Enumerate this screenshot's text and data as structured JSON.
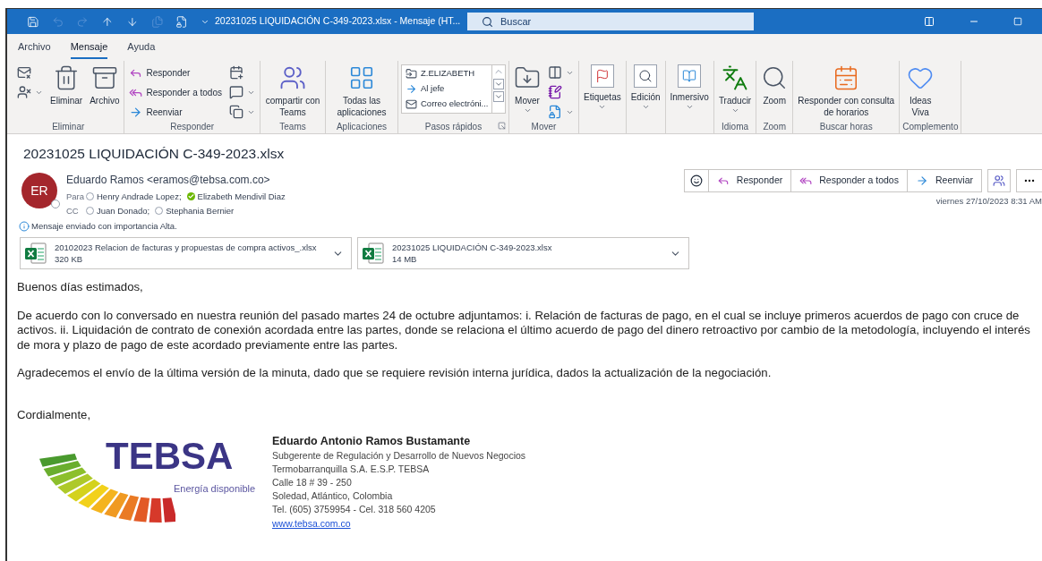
{
  "titlebar": {
    "title": "20231025 LIQUIDACIÓN C-349-2023.xlsx  -  Mensaje (HT...",
    "search": {
      "placeholder": "Buscar"
    }
  },
  "menu_tabs": [
    {
      "label": "Archivo",
      "selected": false
    },
    {
      "label": "Mensaje",
      "selected": true
    },
    {
      "label": "Ayuda",
      "selected": false
    }
  ],
  "ribbon_groups": [
    {
      "label": "Eliminar",
      "columns": [
        {
          "kind": "stack",
          "items": [
            {
              "dropdown": false
            },
            {
              "dropdown": true
            }
          ]
        },
        {
          "kind": "large",
          "label": "Eliminar",
          "dropdown": false
        },
        {
          "kind": "large",
          "label": "Archivo",
          "dropdown": false
        }
      ]
    },
    {
      "label": "Responder",
      "columns": [
        {
          "kind": "stack",
          "items": [
            {
              "label": "Responder",
              "dropdown": false
            },
            {
              "label": "Responder a todos",
              "dropdown": false
            },
            {
              "label": "Reenviar",
              "dropdown": false
            }
          ]
        },
        {
          "kind": "stack",
          "items": [
            {
              "dropdown": false
            },
            {
              "dropdown": true
            },
            {
              "dropdown": true
            }
          ]
        }
      ]
    },
    {
      "label": "Teams",
      "columns": [
        {
          "kind": "large",
          "label": "compartir con Teams",
          "dropdown": false
        }
      ]
    },
    {
      "label": "Aplicaciones",
      "columns": [
        {
          "kind": "large",
          "label": "Todas las aplicaciones",
          "dropdown": false
        }
      ]
    },
    {
      "label": "Pasos rápidos",
      "launcher": true,
      "columns": [
        {
          "kind": "quicksteps",
          "items": [
            "Z.ELIZABETH",
            "Al jefe",
            "Correo electróni..."
          ]
        }
      ]
    },
    {
      "label": "Mover",
      "columns": [
        {
          "kind": "large",
          "label": "Mover",
          "dropdown": true
        },
        {
          "kind": "stack",
          "items": [
            {
              "dropdown": true
            },
            {
              "dropdown": false
            },
            {
              "dropdown": true
            }
          ]
        }
      ]
    },
    {
      "columns": [
        {
          "kind": "large",
          "label": "Etiquetas",
          "dropdown": true
        }
      ]
    },
    {
      "columns": [
        {
          "kind": "large",
          "label": "Edición",
          "dropdown": true
        }
      ]
    },
    {
      "columns": [
        {
          "kind": "large",
          "label": "Inmersivo",
          "dropdown": true
        }
      ]
    },
    {
      "label": "Idioma",
      "columns": [
        {
          "kind": "large",
          "label": "Traducir",
          "dropdown": true
        }
      ]
    },
    {
      "label": "Zoom",
      "columns": [
        {
          "kind": "large",
          "label": "Zoom",
          "dropdown": false
        }
      ]
    },
    {
      "label": "Buscar horas",
      "columns": [
        {
          "kind": "large",
          "label": "Responder con consulta de horarios",
          "dropdown": false
        }
      ]
    },
    {
      "label": "Complemento",
      "columns": [
        {
          "kind": "large",
          "label": "Ideas Viva",
          "dropdown": false
        }
      ]
    }
  ],
  "message": {
    "subject": "20231025 LIQUIDACIÓN C-349-2023.xlsx",
    "sender": {
      "initials": "ER",
      "name": "Eduardo Ramos <eramos@tebsa.com.co>"
    },
    "to_label": "Para",
    "to": [
      {
        "name": "Henry Andrade Lopez;",
        "online": false
      },
      {
        "name": "Elizabeth Mendivil Diaz",
        "online": true
      }
    ],
    "cc_label": "CC",
    "cc": [
      {
        "name": "Juan Donado;",
        "online": false
      },
      {
        "name": "Stephania Bernier",
        "online": false
      }
    ],
    "importance_note": "Mensaje enviado con importancia Alta.",
    "actions": [
      "Responder",
      "Responder a todos",
      "Reenviar"
    ],
    "date": "viernes 27/10/2023 8:31 AM",
    "attachments": [
      {
        "name": "20102023 Relacion de facturas y propuestas de compra activos_.xlsx",
        "size": "320 KB"
      },
      {
        "name": "20231025 LIQUIDACIÓN C-349-2023.xlsx",
        "size": "14 MB"
      }
    ],
    "body": [
      "Buenos días estimados,",
      "De acuerdo con lo conversado en nuestra reunión del pasado martes 24 de octubre adjuntamos: i. Relación de facturas de pago, en el cual se incluye primeros acuerdos de pago con cruce de activos. ii. Liquidación de contrato de conexión acordada entre las partes, donde se relaciona el último acuerdo de pago del dinero retroactivo por cambio de la metodología, incluyendo el interés de mora y plazo de pago de este acordado previamente entre las partes.",
      "Agradecemos el envío de la última versión de la minuta, dado que se requiere revisión interna jurídica, dados la actualización de la negociación.",
      "Cordialmente,"
    ],
    "signature": {
      "logo_name": "TEBSA",
      "logo_tagline": "Energía disponible",
      "name": "Eduardo Antonio Ramos Bustamante",
      "lines": [
        "Subgerente de Regulación y Desarrollo de Nuevos Negocios",
        "Termobarranquilla S.A. E.S.P. TEBSA",
        "Calle 18 # 39 - 250",
        "Soledad, Atlántico, Colombia",
        "Tel. (605) 3759954 - Cel. 318 560 4205"
      ],
      "link": "www.tebsa.com.co"
    }
  }
}
